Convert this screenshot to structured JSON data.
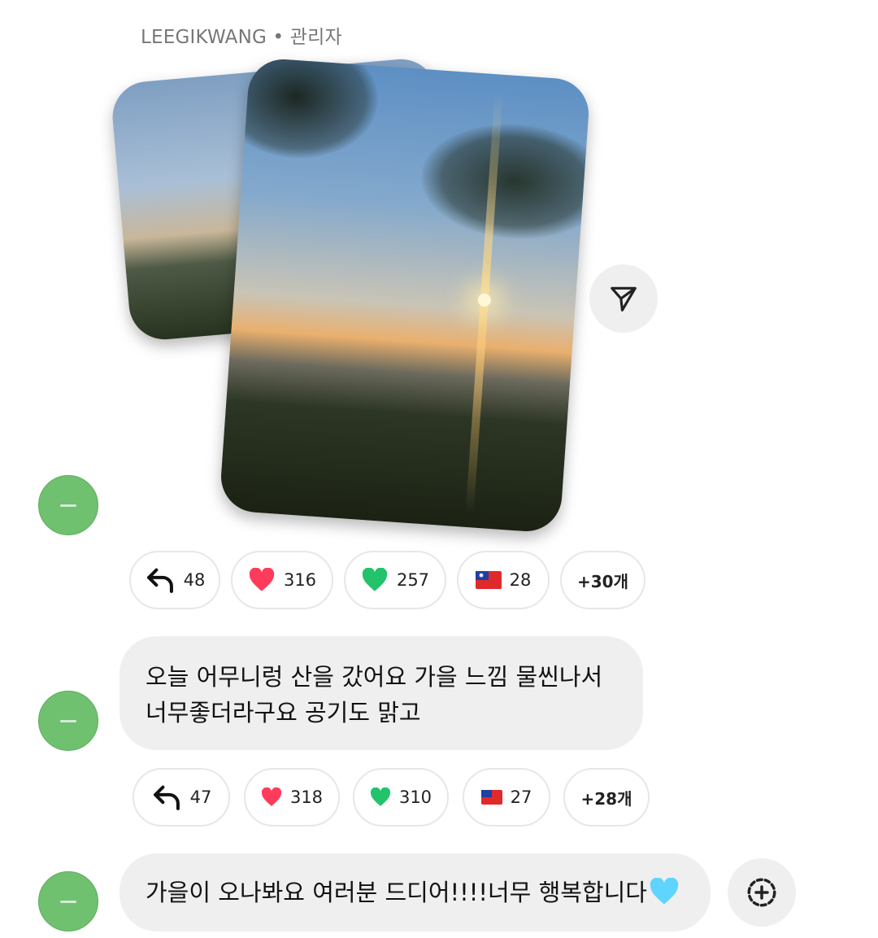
{
  "header": {
    "sender": "LEEGIKWANG • 관리자"
  },
  "message1": {
    "reactions": [
      {
        "icon": "reply-icon",
        "count": "48"
      },
      {
        "icon": "red-heart-icon",
        "count": "316"
      },
      {
        "icon": "green-heart-icon",
        "count": "257"
      },
      {
        "icon": "taiwan-flag-icon",
        "count": "28"
      },
      {
        "more": "+30개"
      }
    ]
  },
  "message2": {
    "line1": "오늘 어무니렁 산을 갔어요 가을 느낌 물씬나서",
    "line2": "너무좋더라구요 공기도 맑고",
    "reactions": [
      {
        "icon": "reply-icon",
        "count": "47"
      },
      {
        "icon": "red-heart-icon",
        "count": "318"
      },
      {
        "icon": "green-heart-icon",
        "count": "310"
      },
      {
        "icon": "taiwan-flag-icon",
        "count": "27"
      },
      {
        "more": "+28개"
      }
    ]
  },
  "message3": {
    "text": "가을이 오나봐요 여러분 드디어!!!!너무 행복합니다"
  },
  "colors": {
    "avatar": "#6fc06f",
    "bubble": "#efefef",
    "red_heart": "#ff3b5c",
    "green_heart": "#22c36b",
    "light_blue_heart": "#5fd4ff"
  }
}
